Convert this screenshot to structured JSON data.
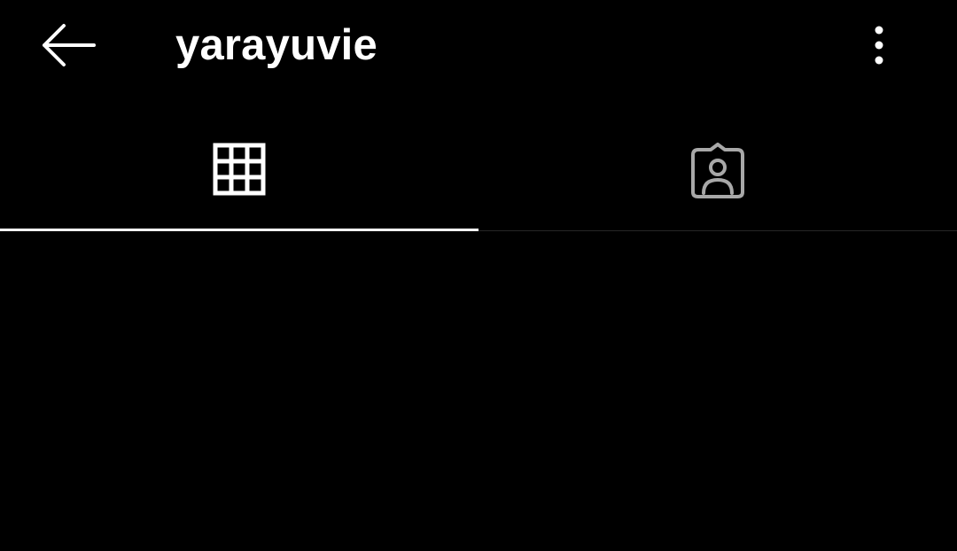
{
  "header": {
    "username": "yarayuvie",
    "back_icon": "arrow-left-icon",
    "more_icon": "more-vertical-icon"
  },
  "tabs": [
    {
      "icon": "grid-icon",
      "selected": true
    },
    {
      "icon": "tagged-person-icon",
      "selected": false
    }
  ],
  "colors": {
    "background": "#000000",
    "text": "#ffffff",
    "inactive_icon": "#a8a8a8",
    "divider": "#262626",
    "active_indicator": "#ffffff"
  }
}
